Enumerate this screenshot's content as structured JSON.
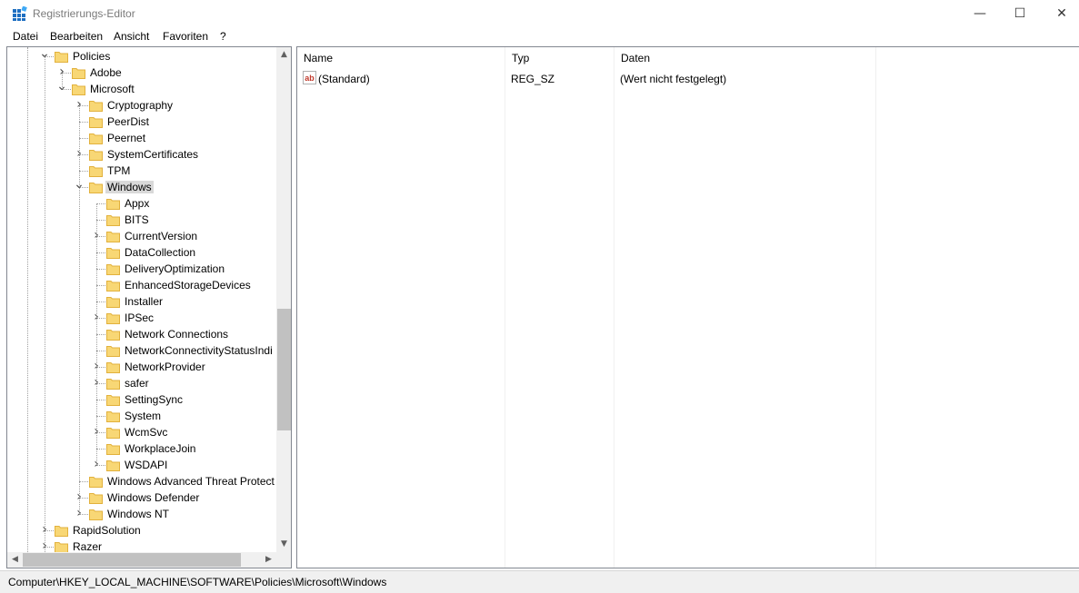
{
  "window": {
    "title": "Registrierungs-Editor",
    "minimize_glyph": "—",
    "maximize_glyph": "☐",
    "close_glyph": "✕"
  },
  "menu": [
    "Datei",
    "Bearbeiten",
    "Ansicht",
    "Favoriten",
    "?"
  ],
  "tree": [
    {
      "label": "Policies",
      "expander": "open"
    },
    {
      "label": "Adobe",
      "expander": "closed"
    },
    {
      "label": "Microsoft",
      "expander": "open"
    },
    {
      "label": "Cryptography",
      "expander": "closed"
    },
    {
      "label": "PeerDist",
      "expander": "none"
    },
    {
      "label": "Peernet",
      "expander": "none"
    },
    {
      "label": "SystemCertificates",
      "expander": "closed"
    },
    {
      "label": "TPM",
      "expander": "none"
    },
    {
      "label": "Windows",
      "expander": "open",
      "selected": true
    },
    {
      "label": "Appx",
      "expander": "none"
    },
    {
      "label": "BITS",
      "expander": "none"
    },
    {
      "label": "CurrentVersion",
      "expander": "closed"
    },
    {
      "label": "DataCollection",
      "expander": "none"
    },
    {
      "label": "DeliveryOptimization",
      "expander": "none"
    },
    {
      "label": "EnhancedStorageDevices",
      "expander": "none"
    },
    {
      "label": "Installer",
      "expander": "none"
    },
    {
      "label": "IPSec",
      "expander": "closed"
    },
    {
      "label": "Network Connections",
      "expander": "none"
    },
    {
      "label": "NetworkConnectivityStatusIndi",
      "expander": "none"
    },
    {
      "label": "NetworkProvider",
      "expander": "closed"
    },
    {
      "label": "safer",
      "expander": "closed"
    },
    {
      "label": "SettingSync",
      "expander": "none"
    },
    {
      "label": "System",
      "expander": "none"
    },
    {
      "label": "WcmSvc",
      "expander": "closed"
    },
    {
      "label": "WorkplaceJoin",
      "expander": "none"
    },
    {
      "label": "WSDAPI",
      "expander": "closed"
    },
    {
      "label": "Windows Advanced Threat Protect",
      "expander": "none"
    },
    {
      "label": "Windows Defender",
      "expander": "closed"
    },
    {
      "label": "Windows NT",
      "expander": "closed"
    },
    {
      "label": "RapidSolution",
      "expander": "closed"
    },
    {
      "label": "Razer",
      "expander": "closed"
    }
  ],
  "columns": {
    "name": "Name",
    "type": "Typ",
    "data": "Daten"
  },
  "values": [
    {
      "name": "(Standard)",
      "type": "REG_SZ",
      "data": "(Wert nicht festgelegt)",
      "icon": "string-value-icon",
      "icon_text": "ab"
    }
  ],
  "status": "Computer\\HKEY_LOCAL_MACHINE\\SOFTWARE\\Policies\\Microsoft\\Windows",
  "colors": {
    "folder": "#f8d775",
    "folder_dark": "#e2b13c",
    "selection": "#d9d9d9",
    "string_icon": "#c0392b"
  }
}
